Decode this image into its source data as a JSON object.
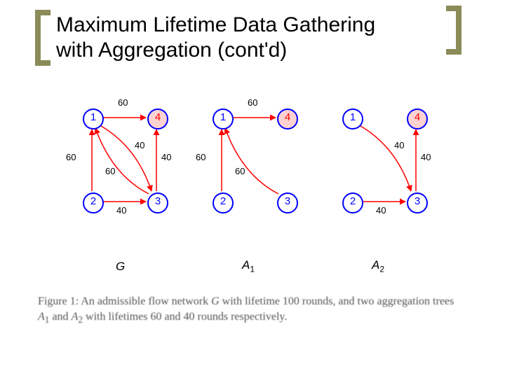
{
  "title_line1": "Maximum Lifetime Data Gathering",
  "title_line2": "with Aggregation (cont'd)",
  "graphs": [
    {
      "label_html": "G",
      "nodes": {
        "n1": "1",
        "n2": "2",
        "n3": "3",
        "n4": "4"
      },
      "edge_labels": {
        "top": "60",
        "left": "60",
        "diagLeft": "60",
        "diagRight": "40",
        "right": "40",
        "bottom": "40"
      }
    },
    {
      "label_html": "A1",
      "nodes": {
        "n1": "1",
        "n2": "2",
        "n3": "3",
        "n4": "4"
      },
      "edge_labels": {
        "top": "60",
        "left": "60",
        "diagLeft": "60"
      }
    },
    {
      "label_html": "A2",
      "nodes": {
        "n1": "1",
        "n2": "2",
        "n3": "3",
        "n4": "4"
      },
      "edge_labels": {
        "diagRight": "40",
        "right": "40",
        "bottom": "40"
      }
    }
  ],
  "caption_prefix": "Figure 1: An admissible flow network ",
  "caption_G": "G",
  "caption_mid1": " with lifetime 100 rounds, and two aggregation trees ",
  "caption_A1": "A",
  "caption_s1": "1",
  "caption_and": " and ",
  "caption_A2": "A",
  "caption_s2": "2",
  "caption_tail": " with lifetimes 60 and 40 rounds respectively."
}
